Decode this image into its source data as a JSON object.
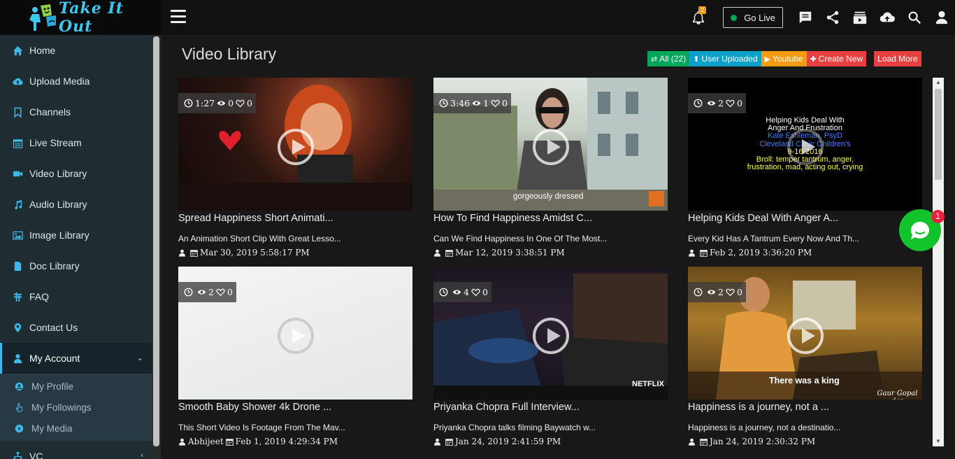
{
  "app": {
    "logo_text": "Take It Out"
  },
  "topbar": {
    "notification_count": "2",
    "golive_label": "Go Live",
    "icons": [
      "bell-icon",
      "chat-icon",
      "share-icon",
      "media-icon",
      "upload-cloud-icon",
      "search-icon",
      "user-icon"
    ]
  },
  "sidebar": {
    "items": [
      {
        "label": "Home",
        "icon": "home-icon"
      },
      {
        "label": "Upload Media",
        "icon": "cloud-upload-icon"
      },
      {
        "label": "Channels",
        "icon": "bookmark-icon"
      },
      {
        "label": "Live Stream",
        "icon": "calendar-icon"
      },
      {
        "label": "Video Library",
        "icon": "video-camera-icon"
      },
      {
        "label": "Audio Library",
        "icon": "music-icon"
      },
      {
        "label": "Image Library",
        "icon": "image-icon"
      },
      {
        "label": "Doc Library",
        "icon": "document-icon"
      },
      {
        "label": "FAQ",
        "icon": "faq-icon"
      },
      {
        "label": "Contact Us",
        "icon": "map-marker-icon"
      },
      {
        "label": "My Account",
        "icon": "user-icon"
      }
    ],
    "subitems": [
      {
        "label": "My Profile",
        "icon": "user-circle-icon"
      },
      {
        "label": "My Followings",
        "icon": "hand-pointer-icon"
      },
      {
        "label": "My Media",
        "icon": "play-circle-icon"
      }
    ],
    "vc_label": "VC"
  },
  "main": {
    "title": "Video Library",
    "filters": {
      "all": "All (22)",
      "user_uploaded": "User Uploaded",
      "youtube": "Youtube",
      "create_new": "Create New",
      "load_more": "Load More"
    },
    "videos": [
      {
        "duration": "1:27",
        "views": "0",
        "likes": "0",
        "title": "Spread Happiness Short Animati...",
        "desc": "An Animation Short Clip With Great Lesso...",
        "author": "",
        "date": "Mar 30, 2019 5:58:17 PM"
      },
      {
        "duration": "3:46",
        "views": "1",
        "likes": "0",
        "title": "How To Find Happiness Amidst C...",
        "desc": "Can We Find Happiness In One Of The Most...",
        "author": "",
        "date": "Mar 12, 2019 3:38:51 PM",
        "caption": "gorgeously dressed"
      },
      {
        "duration": "",
        "views": "2",
        "likes": "0",
        "title": "Helping Kids Deal With Anger A...",
        "desc": "Every Kid Has A Tantrum Every Now And Th...",
        "author": "",
        "date": "Feb 2, 2019 3:36:20 PM",
        "slide": {
          "line1": "Helping Kids Deal With",
          "line2": "Anger And Frustration",
          "line3": "Kate Eshleman, PsyD",
          "line4": "Cleveland Clinic Children's",
          "line5": "9-16-2016",
          "line6": "Broll: temper tantrum, anger,",
          "line7": "frustration, mad, acting out, crying"
        }
      },
      {
        "duration": "",
        "views": "2",
        "likes": "0",
        "title": "Smooth Baby Shower 4k Drone ...",
        "desc": "This Short Video Is Footage From The Mav...",
        "author": "Abhijeet",
        "date": "Feb 1, 2019 4:29:34 PM"
      },
      {
        "duration": "",
        "views": "4",
        "likes": "0",
        "title": "Priyanka Chopra Full Interview...",
        "desc": "Priyanka Chopra talks filming Baywatch w...",
        "author": "",
        "date": "Jan 24, 2019 2:41:59 PM",
        "caption": "NETFLIX"
      },
      {
        "duration": "",
        "views": "2",
        "likes": "0",
        "title": "Happiness is a journey, not a ...",
        "desc": "Happiness is a journey, not a destinatio...",
        "author": "",
        "date": "Jan 24, 2019 2:30:32 PM",
        "caption": "There was a king",
        "signature": "Gaur Gopal das"
      }
    ]
  },
  "chat_widget": {
    "badge": "1"
  },
  "colors": {
    "accent": "#3cb9e6",
    "green": "#00a65a",
    "youtube": "#f39c12",
    "red": "#e84040",
    "sidebar": "#1f2d33"
  }
}
